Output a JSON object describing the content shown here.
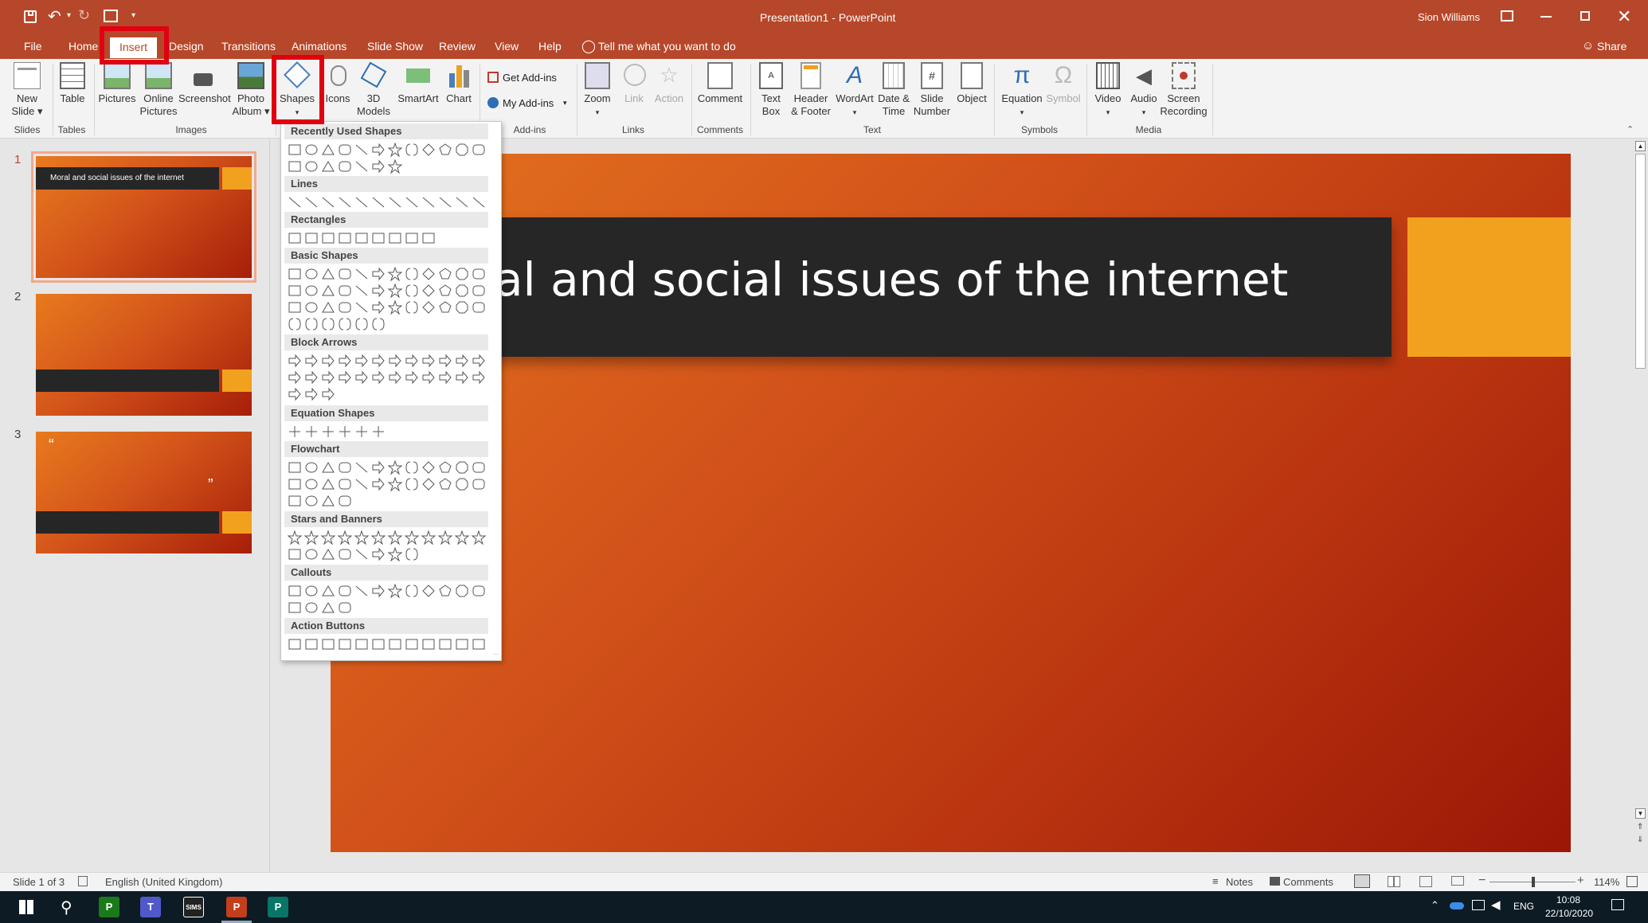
{
  "window": {
    "title": "Presentation1 - PowerPoint",
    "user": "Sion Williams",
    "controls": [
      "minimize",
      "restore",
      "close"
    ]
  },
  "tabs": [
    {
      "label": "File"
    },
    {
      "label": "Home"
    },
    {
      "label": "Insert"
    },
    {
      "label": "Design"
    },
    {
      "label": "Transitions"
    },
    {
      "label": "Animations"
    },
    {
      "label": "Slide Show"
    },
    {
      "label": "Review"
    },
    {
      "label": "View"
    },
    {
      "label": "Help"
    }
  ],
  "tell_me": "Tell me what you want to do",
  "share": "Share",
  "ribbon": {
    "new_slide": [
      "New",
      "Slide ▾"
    ],
    "table": "Table",
    "pictures": "Pictures",
    "online_pictures": [
      "Online",
      "Pictures"
    ],
    "screenshot": "Screenshot",
    "photo_album": [
      "Photo",
      "Album ▾"
    ],
    "shapes": "Shapes",
    "icons": "Icons",
    "models3d": [
      "3D",
      "Models ▾"
    ],
    "smartart": "SmartArt",
    "chart": "Chart",
    "get_addins": "Get Add-ins",
    "my_addins": "My Add-ins",
    "zoom": "Zoom",
    "link": "Link",
    "action": "Action",
    "comment": "Comment",
    "text_box": [
      "Text",
      "Box"
    ],
    "header_footer": [
      "Header",
      "& Footer"
    ],
    "wordart": "WordArt",
    "date_time": [
      "Date &",
      "Time"
    ],
    "slide_number": [
      "Slide",
      "Number"
    ],
    "object": "Object",
    "equation": "Equation",
    "symbol": "Symbol",
    "video": "Video",
    "audio": "Audio",
    "screen_recording": [
      "Screen",
      "Recording"
    ],
    "groups": {
      "slides": "Slides",
      "tables": "Tables",
      "images": "Images",
      "addins": "Add-ins",
      "links": "Links",
      "comments": "Comments",
      "text": "Text",
      "symbols": "Symbols",
      "media": "Media"
    }
  },
  "shapes_menu": {
    "sections": [
      "Recently Used Shapes",
      "Lines",
      "Rectangles",
      "Basic Shapes",
      "Block Arrows",
      "Equation Shapes",
      "Flowchart",
      "Stars and Banners",
      "Callouts",
      "Action Buttons"
    ]
  },
  "slides": [
    {
      "num": "1",
      "title": "Moral and social issues of the internet"
    },
    {
      "num": "2"
    },
    {
      "num": "3",
      "quote_open": "“",
      "quote_close": "”"
    }
  ],
  "current_slide": {
    "title_visible": "al and social issues of the internet"
  },
  "status": {
    "slide_info": "Slide 1 of 3",
    "language": "English (United Kingdom)",
    "notes": "Notes",
    "comments": "Comments",
    "zoom": "114%"
  },
  "taskbar": {
    "language": "ENG",
    "time": "10:08",
    "date": "22/10/2020"
  },
  "colors": {
    "accent": "#b7472a",
    "slide_orange": "#f2a11f",
    "highlight": "#e00010"
  }
}
